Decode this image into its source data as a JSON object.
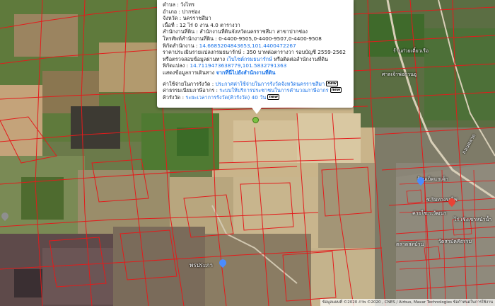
{
  "popup": {
    "rows": [
      {
        "label": "ตำบล : ",
        "value": "วังไทร"
      },
      {
        "label": "อำเภอ : ",
        "value": "ปากช่อง"
      },
      {
        "label": "จังหวัด : ",
        "value": "นครราชสีมา"
      },
      {
        "label": "เนื้อที่ : ",
        "value": "12 ไร่ 0 งาน 4.0 ตารางวา"
      },
      {
        "label": "สำนักงานที่ดิน : ",
        "value": "สำนักงานที่ดินจังหวัดนครราชสีมา สาขาปากช่อง"
      },
      {
        "label": "โทรศัพท์สำนักงานที่ดิน : ",
        "value": "0-4400-9505,0-4400-9507,0-4400-9508"
      },
      {
        "label": "พิกัดสำนักงาน : ",
        "value": "14.6685204843653,101.4400472267"
      },
      {
        "label": "ราคาประเมินรายแปลงกรมธนารักษ์ : ",
        "value": "350 บาทต่อตารางวา รอบบัญชี 2559-2562"
      },
      {
        "label": "หรือตรวจสอบข้อมูลผ่านทาง ",
        "value": "เว็บไซต์กรมธนารักษ์",
        "suffix": " หรือติดต่อสำนักงานที่ดิน"
      },
      {
        "label": "พิกัดแปลง : ",
        "value": "14.7119473638779,101.5832791363"
      },
      {
        "label": "แสดงข้อมูลการเดินทาง ",
        "value": "จากที่นี่ไปยังสำนักงานที่ดิน"
      }
    ],
    "rows2": [
      {
        "label": "ค่าใช้จ่ายในการรังวัด : ",
        "value": "ประกาศค่าใช้จ่ายในการรังวัดจังหวัดนครราชสีมา",
        "badge": "new"
      },
      {
        "label": "ค่าธรรมเนียมภาษีอากร : ",
        "value": "ระบบให้บริการประชาชนในการคำนวณภาษีอากร",
        "badge": "new"
      },
      {
        "label": "คิวรังวัด : ",
        "value": "ระยะเวลาการรังวัด(คิวรังวัด) 40 วัน",
        "badge": "new"
      }
    ]
  },
  "labels": {
    "poi1": "ร้านก๋วยเตี๋ยวเรือ",
    "poi2": "ร้านเบ็ดแกเด็ก",
    "poi3": "ซ.ริมทางรถไฟ",
    "poi4": "ศาลเจ้าพ่อกวนอู",
    "poi5": "คายไซ.ว.วัฒนา",
    "poi6": "ไร่ เชิงเขาหนำน้ำ",
    "poi7": "วัดสามัคคีธรรม",
    "poi8": "ตลาดสดบ้าน",
    "poi9": "พรประภา",
    "poi10": "ถนนตลาด"
  },
  "attribution": "ข้อมูลแผนที่ ©2020 ภาพ ©2020 , CNES / Airbus, Maxar Technologies ข้อกำหนดในการใช้งาน",
  "colors": {
    "parcel_line": "#e31b1b",
    "popup_link": "#1a73e8",
    "marker": "#7ac143"
  }
}
